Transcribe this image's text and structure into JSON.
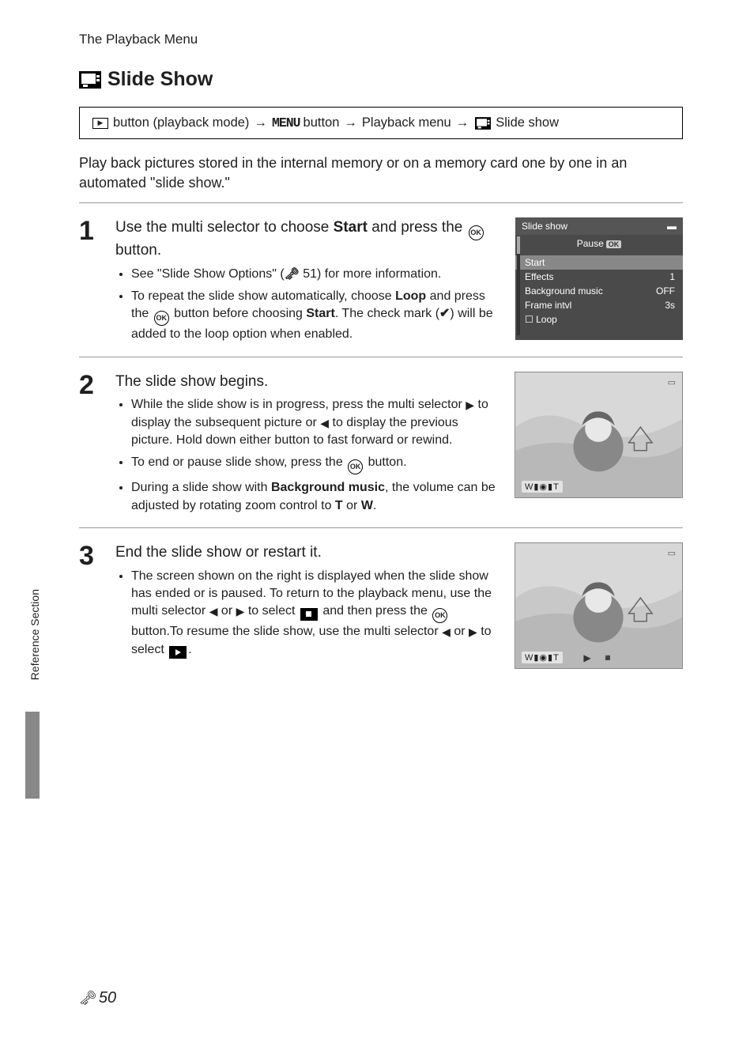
{
  "header": {
    "chapter": "The Playback Menu"
  },
  "title": "Slide Show",
  "breadcrumb": {
    "part1": "button (playback mode)",
    "part2_menu": "MENU",
    "part2_after": "button",
    "part3": "Playback menu",
    "part4": "Slide show"
  },
  "intro": "Play back pictures stored in the internal memory or on a memory card one by one in an automated \"slide show.\"",
  "steps": [
    {
      "num": "1",
      "heading_pre": "Use the multi selector to choose ",
      "heading_bold": "Start",
      "heading_mid": " and press the ",
      "heading_post": " button.",
      "bullets": [
        {
          "pre": "See \"Slide Show Options\" (",
          "ref": "51",
          "post": ") for more information."
        },
        {
          "pre": "To repeat the slide show automatically, choose ",
          "bold1": "Loop",
          "mid1": " and press the ",
          "mid2": " button before choosing ",
          "bold2": "Start",
          "mid3": ". The check mark (",
          "mid4": ") will be added to the loop option when enabled."
        }
      ]
    },
    {
      "num": "2",
      "heading": "The slide show begins.",
      "bullets": [
        {
          "text_pre": "While the slide show is in progress, press the multi selector ",
          "text_mid1": " to display the subsequent picture or ",
          "text_mid2": " to display the previous picture. Hold down either button to fast forward or rewind."
        },
        {
          "text_pre": "To end or pause slide show, press the ",
          "text_post": " button."
        },
        {
          "text_pre": "During a slide show with ",
          "bold": "Background music",
          "text_mid": ", the volume can be adjusted by rotating zoom control to ",
          "t": "T",
          "or": " or ",
          "w": "W",
          "end": "."
        }
      ]
    },
    {
      "num": "3",
      "heading": "End the slide show or restart it.",
      "bullets": [
        {
          "l1": "The screen shown on the right is displayed when the slide show has ended or is paused. To return to the playback menu, use the multi selector ",
          "l2": " or ",
          "l3": " to select ",
          "l4": " and then press the ",
          "l5": " button.To resume the slide show, use the multi selector ",
          "l6": " or ",
          "l7": " to select ",
          "l8": "."
        }
      ]
    }
  ],
  "cam_screen": {
    "title": "Slide show",
    "pause": "Pause",
    "rows": [
      {
        "label": "Start",
        "value": "",
        "highlight": true
      },
      {
        "label": "Effects",
        "value": "1"
      },
      {
        "label": "Background music",
        "value": "OFF"
      },
      {
        "label": "Frame intvl",
        "value": "3s"
      },
      {
        "label": "Loop",
        "value": "",
        "checkbox": true
      }
    ]
  },
  "side_tab": "Reference Section",
  "footer": {
    "page": "50"
  }
}
